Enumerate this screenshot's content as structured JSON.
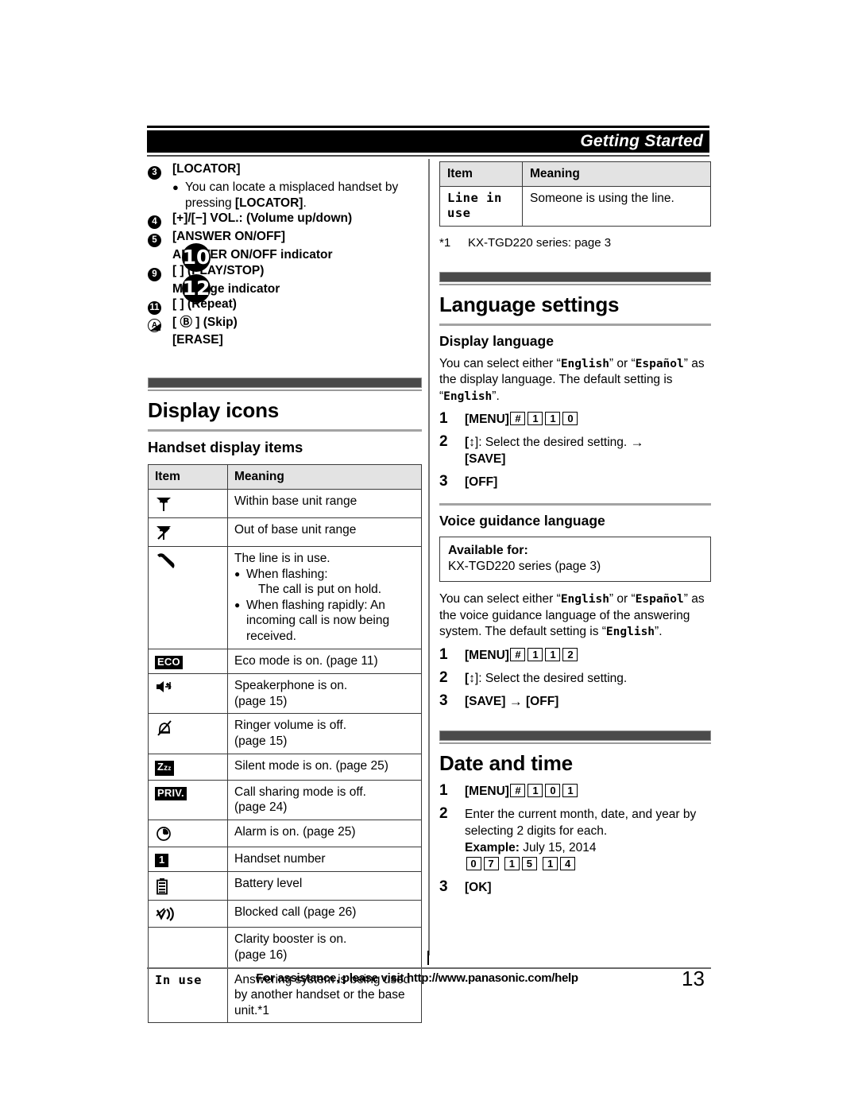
{
  "header": {
    "title": "Getting Started"
  },
  "callouts": {
    "items": [
      {
        "num": "3",
        "num_style": "disc",
        "text": "[LOCATOR]",
        "bold": true
      },
      {
        "bullet": true,
        "text": "You can locate a misplaced handset by pressing [LOCATOR]."
      },
      {
        "num": "4",
        "num_style": "disc",
        "text": "[+]/[−] VOL.: (Volume up/down)",
        "bold": true
      },
      {
        "num": "5",
        "num_style": "disc",
        "text": "[ANSWER ON/OFF]",
        "bold": true
      },
      {
        "num": "",
        "num_style": "none",
        "text": "ANSWER ON/OFF indicator",
        "bold": true
      },
      {
        "num": "9",
        "num_style": "disc",
        "text": "[ ] (PLAY/STOP)",
        "bold": true
      },
      {
        "num": "",
        "num_style": "none",
        "text": "Message indicator",
        "bold": true
      },
      {
        "num": "11",
        "num_style": "disc",
        "text": "[ ] (Repeat)",
        "bold": true
      },
      {
        "num": "A",
        "num_style": "ring",
        "text": "[ Ⓑ ] (Skip)",
        "bold": true
      },
      {
        "num": "",
        "num_style": "none",
        "text": "[ERASE]",
        "bold": true
      }
    ],
    "overlap_discs": [
      "10",
      "12"
    ]
  },
  "display_icons": {
    "section_title": "Display icons",
    "sub_title": "Handset display items",
    "table": {
      "headers": [
        "Item",
        "Meaning"
      ],
      "rows": [
        {
          "icon": "antenna-in-range-icon",
          "item_text": "",
          "meaning": "Within base unit range"
        },
        {
          "icon": "antenna-out-of-range-icon",
          "item_text": "",
          "meaning": "Out of base unit range"
        },
        {
          "icon": "handset-off-hook-icon",
          "item_text": "",
          "meaning": "The line is in use.",
          "bullets": [
            {
              "main": "When flashing:",
              "cont": "The call is put on hold."
            },
            {
              "main": "When flashing rapidly: An incoming call is now being received.",
              "cont": ""
            }
          ]
        },
        {
          "icon": "eco-badge-icon",
          "item_text": "ECO",
          "meaning": "Eco mode is on. (page 11)"
        },
        {
          "icon": "speakerphone-icon",
          "item_text": "",
          "meaning": "Speakerphone is on.\n(page 15)"
        },
        {
          "icon": "ringer-off-icon",
          "item_text": "",
          "meaning": "Ringer volume is off.\n(page 15)"
        },
        {
          "icon": "silent-mode-icon",
          "item_text": "Zzz",
          "meaning": "Silent mode is on. (page 25)"
        },
        {
          "icon": "privacy-badge-icon",
          "item_text": "PRIV.",
          "meaning": "Call sharing mode is off.\n(page 24)"
        },
        {
          "icon": "alarm-clock-icon",
          "item_text": "",
          "meaning": "Alarm is on. (page 25)"
        },
        {
          "icon": "handset-number-icon",
          "item_text": "1",
          "meaning": "Handset number"
        },
        {
          "icon": "battery-icon",
          "item_text": "",
          "meaning": "Battery level"
        },
        {
          "icon": "blocked-call-icon",
          "item_text": "",
          "meaning": "Blocked call (page 26)"
        },
        {
          "icon": "",
          "item_text": "",
          "meaning": "Clarity booster is on.\n(page 16)"
        },
        {
          "icon": "in-use-text-icon",
          "item_text": "In use",
          "mono": true,
          "meaning": "Answering system is being used by another handset or the base unit.*1"
        }
      ]
    }
  },
  "line_in_use_table": {
    "headers": [
      "Item",
      "Meaning"
    ],
    "rows": [
      {
        "item": "Line in use",
        "meaning": "Someone is using the line."
      }
    ]
  },
  "footnote": {
    "mark": "*1",
    "text": "KX-TGD220 series: page 3"
  },
  "language_settings": {
    "section_title": "Language settings",
    "display_language": {
      "title": "Display language",
      "paragraph_parts": [
        "You can select either “",
        "English",
        "” or “",
        "Español",
        "” as the display language. The default setting is “",
        "English",
        "”."
      ],
      "steps": [
        {
          "n": "1",
          "label": "[MENU]",
          "keys": [
            "#",
            "1",
            "1",
            "0"
          ]
        },
        {
          "n": "2",
          "text_before": "[",
          "nav": "↕",
          "text_after": "]: Select the desired setting.",
          "arrow": "→",
          "then": "[SAVE]"
        },
        {
          "n": "3",
          "label": "[OFF]"
        }
      ]
    },
    "voice_guidance": {
      "title": "Voice guidance language",
      "available_label": "Available for:",
      "available_value": "KX-TGD220 series (page 3)",
      "paragraph_parts": [
        "You can select either “",
        "English",
        "” or “",
        "Español",
        "” as the voice guidance language of the answering system. The default setting is “",
        "English",
        "”."
      ],
      "steps": [
        {
          "n": "1",
          "label": "[MENU]",
          "keys": [
            "#",
            "1",
            "1",
            "2"
          ]
        },
        {
          "n": "2",
          "text_before": "[",
          "nav": "↕",
          "text_after": "]: Select the desired setting."
        },
        {
          "n": "3",
          "label": "[SAVE]",
          "arrow": "→",
          "then": "[OFF]"
        }
      ]
    }
  },
  "date_and_time": {
    "section_title": "Date and time",
    "steps": [
      {
        "n": "1",
        "label": "[MENU]",
        "keys": [
          "#",
          "1",
          "0",
          "1"
        ]
      },
      {
        "n": "2",
        "text": "Enter the current month, date, and year by selecting 2 digits for each.",
        "example_label": "Example:",
        "example_value": "July 15, 2014",
        "example_keys": [
          "0",
          "7",
          "1",
          "5",
          "1",
          "4"
        ]
      },
      {
        "n": "3",
        "label": "[OK]"
      }
    ]
  },
  "footer": {
    "text": "For assistance, please visit http://www.panasonic.com/help",
    "page_number": "13"
  }
}
